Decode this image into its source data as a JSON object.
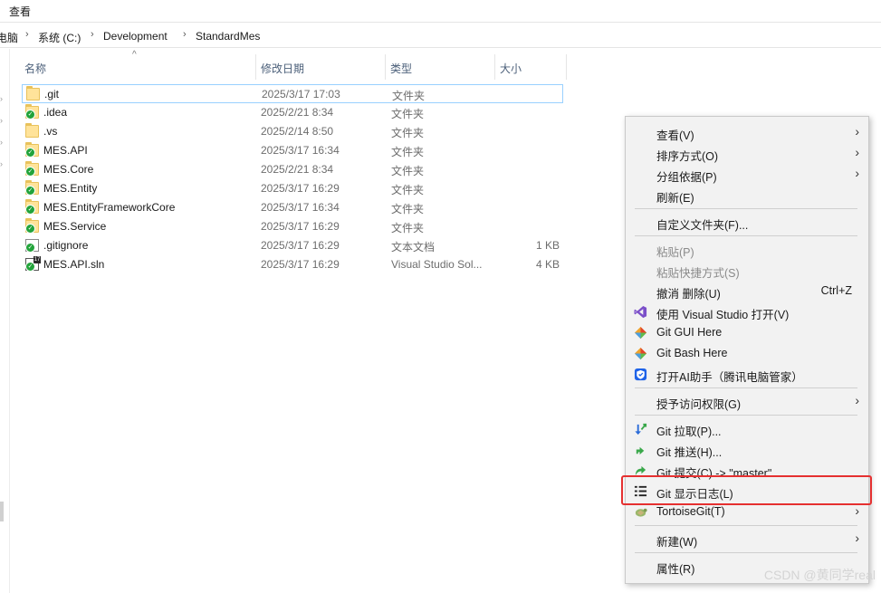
{
  "menubar": {
    "view_label": "查看"
  },
  "breadcrumb": {
    "items": [
      "电脑",
      "系统 (C:)",
      "Development",
      "StandardMes"
    ]
  },
  "columns": {
    "name": "名称",
    "date": "修改日期",
    "type": "类型",
    "size": "大小"
  },
  "files": [
    {
      "name": ".git",
      "date": "2025/3/17 17:03",
      "type": "文件夹",
      "size": ""
    },
    {
      "name": ".idea",
      "date": "2025/2/21 8:34",
      "type": "文件夹",
      "size": ""
    },
    {
      "name": ".vs",
      "date": "2025/2/14 8:50",
      "type": "文件夹",
      "size": ""
    },
    {
      "name": "MES.API",
      "date": "2025/3/17 16:34",
      "type": "文件夹",
      "size": ""
    },
    {
      "name": "MES.Core",
      "date": "2025/2/21 8:34",
      "type": "文件夹",
      "size": ""
    },
    {
      "name": "MES.Entity",
      "date": "2025/3/17 16:29",
      "type": "文件夹",
      "size": ""
    },
    {
      "name": "MES.EntityFrameworkCore",
      "date": "2025/3/17 16:34",
      "type": "文件夹",
      "size": ""
    },
    {
      "name": "MES.Service",
      "date": "2025/3/17 16:29",
      "type": "文件夹",
      "size": ""
    },
    {
      "name": ".gitignore",
      "date": "2025/3/17 16:29",
      "type": "文本文档",
      "size": "1 KB"
    },
    {
      "name": "MES.API.sln",
      "date": "2025/3/17 16:29",
      "type": "Visual Studio Sol...",
      "size": "4 KB"
    }
  ],
  "context_menu": {
    "view": "查看(V)",
    "sort": "排序方式(O)",
    "group": "分组依据(P)",
    "refresh": "刷新(E)",
    "customize": "自定义文件夹(F)...",
    "paste": "粘贴(P)",
    "paste_shortcut": "粘贴快捷方式(S)",
    "undo_delete": "撤消 删除(U)",
    "undo_shortcut": "Ctrl+Z",
    "open_vs": "使用 Visual Studio 打开(V)",
    "git_gui": "Git GUI Here",
    "git_bash": "Git Bash Here",
    "ai_assistant": "打开AI助手（腾讯电脑管家）",
    "grant_access": "授予访问权限(G)",
    "git_pull": "Git 拉取(P)...",
    "git_push": "Git 推送(H)...",
    "git_commit": "Git 提交(C) -> \"master\"...",
    "git_log": "Git 显示日志(L)",
    "tortoisegit": "TortoiseGit(T)",
    "new": "新建(W)",
    "properties": "属性(R)"
  },
  "watermark": "CSDN @黄同学real",
  "colors": {
    "highlight": "#e53030",
    "folder": "#ffe39a",
    "badge": "#22a33a"
  },
  "icons": {
    "vs": "visual-studio-icon",
    "git": "git-diamond-icon",
    "shield": "shield-icon",
    "pull": "git-pull-icon",
    "push": "git-push-icon",
    "commit": "git-commit-icon",
    "log": "git-log-icon",
    "tortoise": "tortoisegit-icon"
  }
}
